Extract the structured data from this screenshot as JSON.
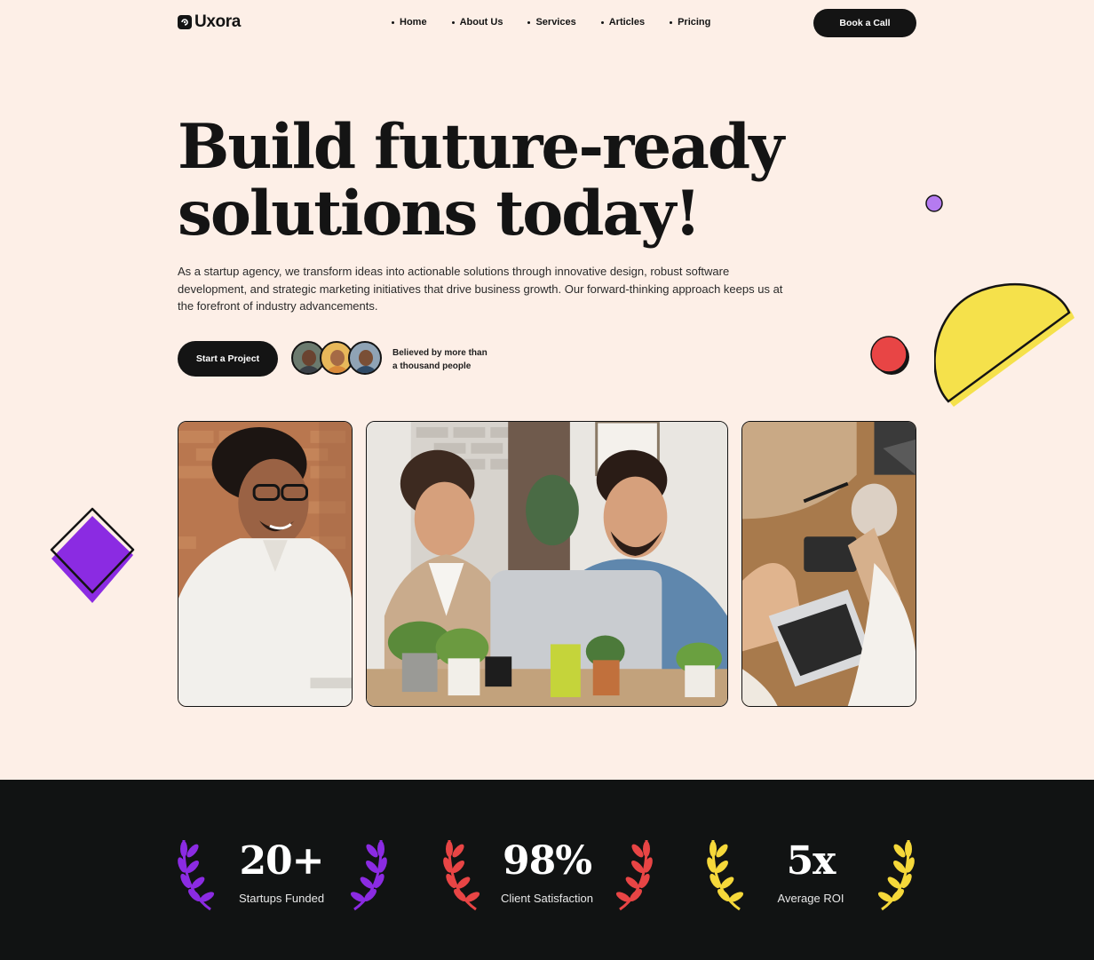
{
  "brand": {
    "name": "Uxora"
  },
  "nav": {
    "items": [
      {
        "label": "Home"
      },
      {
        "label": "About Us"
      },
      {
        "label": "Services"
      },
      {
        "label": "Articles"
      },
      {
        "label": "Pricing"
      }
    ],
    "cta_label": "Book a Call"
  },
  "hero": {
    "title_line1": "Build future-ready",
    "title_line2": "solutions today!",
    "description": "As a startup agency, we transform ideas into actionable solutions through innovative design, robust software development, and strategic marketing initiatives that drive business growth. Our forward-thinking approach keeps us at the forefront of industry advancements.",
    "cta_label": "Start a Project",
    "trust_line1": "Believed by more than",
    "trust_line2": "a thousand people"
  },
  "stats": [
    {
      "value": "20+",
      "label": "Startups Funded",
      "color": "#8b2be2"
    },
    {
      "value": "98%",
      "label": "Client Satisfaction",
      "color": "#e84545"
    },
    {
      "value": "5x",
      "label": "Average ROI",
      "color": "#f5d83a"
    }
  ],
  "colors": {
    "background": "#fdefe7",
    "dark": "#141414",
    "purple": "#8b2be2",
    "red": "#e84545",
    "yellow": "#f5e14b",
    "lilac": "#b57bf0"
  }
}
